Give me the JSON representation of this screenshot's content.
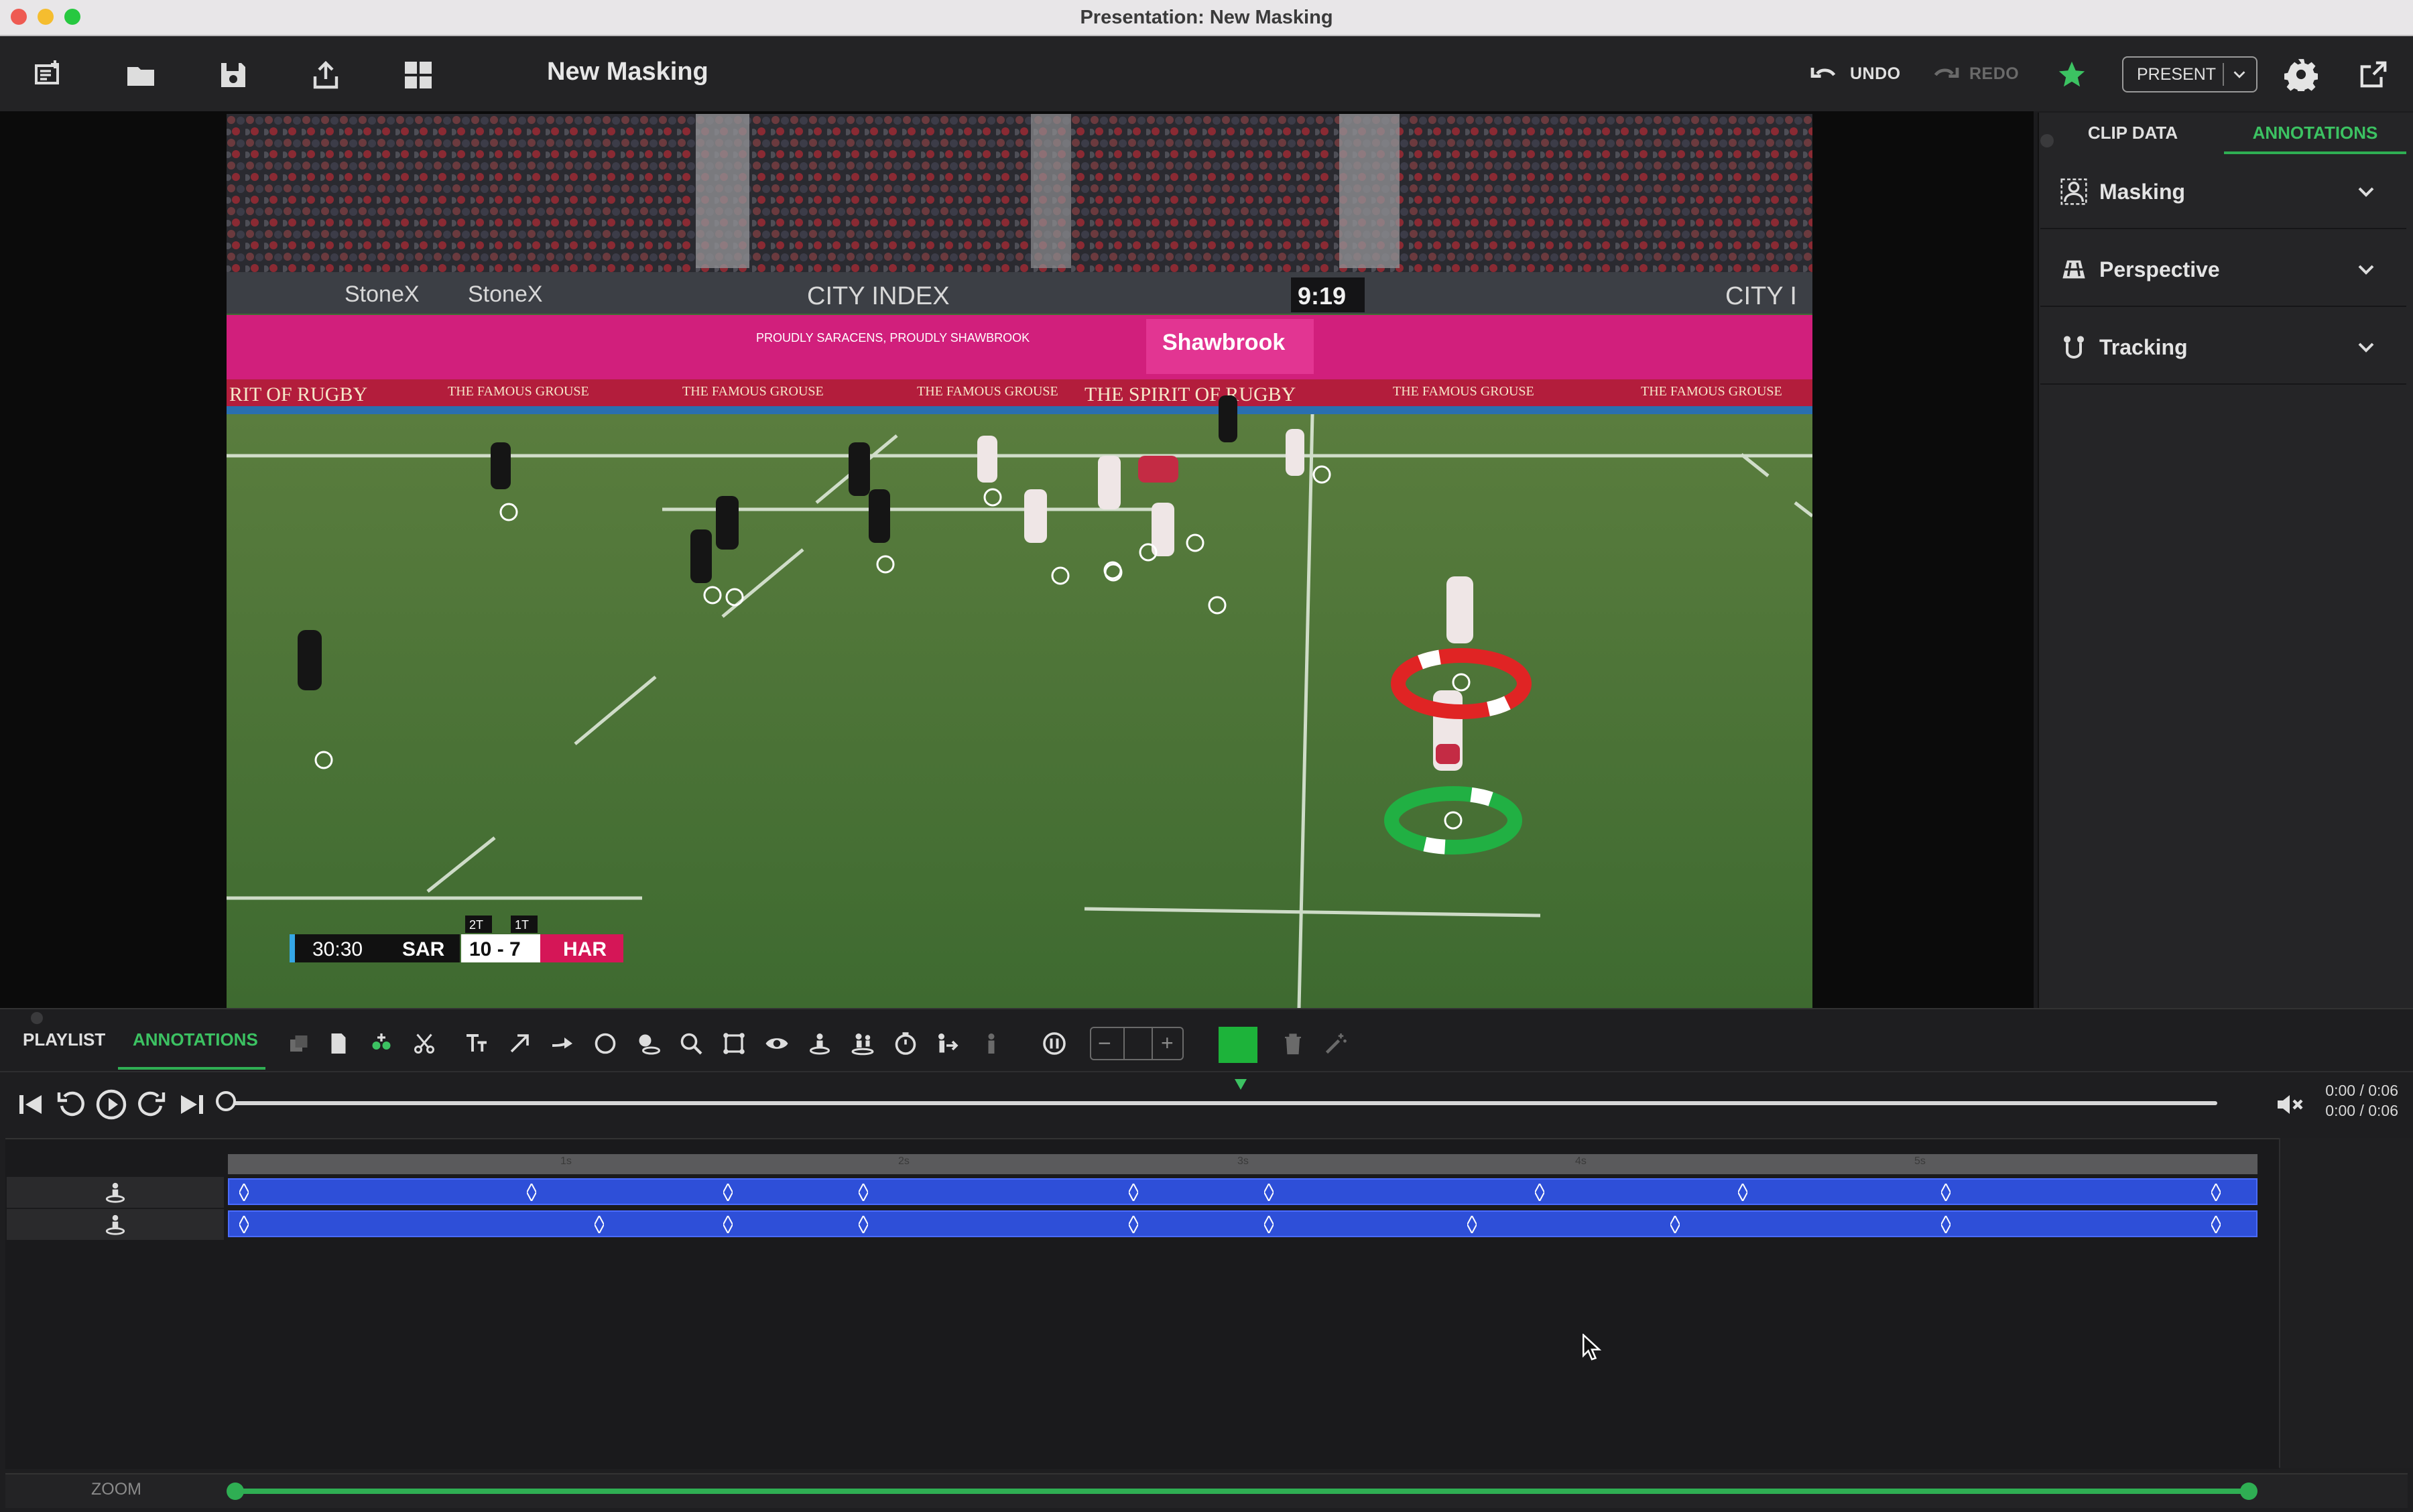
{
  "window": {
    "title": "Presentation: New Masking"
  },
  "toolbar": {
    "document_title": "New Masking",
    "undo_label": "UNDO",
    "redo_label": "REDO",
    "present_label": "PRESENT",
    "icons": [
      "new-presentation-icon",
      "folder-icon",
      "save-icon",
      "share-icon",
      "layout-icon",
      "undo-icon",
      "redo-icon",
      "star-icon",
      "gear-icon",
      "external-window-icon"
    ]
  },
  "video": {
    "scoreboard": {
      "clock": "30:30",
      "home": "SAR",
      "score": "10 - 7",
      "away": "HAR",
      "home_half": "2T",
      "away_half": "1T"
    },
    "stadium_clock": "9:19",
    "boards": [
      "StoneX",
      "StoneX",
      "CITY INDEX",
      "CITY I",
      "Shawbrook",
      "THE FAMOUS GROUSE",
      "THE FAMOUS GROUSE",
      "THE FAMOUS GROUSE",
      "THE FAMOUS GROUSE",
      "THE FAMOUS GROUSE",
      "THE SPIRIT OF RUGBY",
      "RIT OF RUGBY",
      "PROUDLY SARACENS, PROUDLY SHAWBROOK"
    ]
  },
  "right_panel": {
    "tabs": [
      {
        "label": "CLIP DATA"
      },
      {
        "label": "ANNOTATIONS",
        "active": true
      }
    ],
    "sections": [
      {
        "label": "Masking",
        "icon": "masking-icon"
      },
      {
        "label": "Perspective",
        "icon": "perspective-icon"
      },
      {
        "label": "Tracking",
        "icon": "tracking-icon"
      }
    ],
    "accent_color": "#2fae53"
  },
  "bottom": {
    "tabs": [
      {
        "label": "PLAYLIST"
      },
      {
        "label": "ANNOTATIONS",
        "active": true
      }
    ],
    "tools": [
      "copy-icon",
      "document-icon",
      "add-group-icon",
      "scissors-icon",
      "text-icon",
      "arrow-icon",
      "curved-arrow-icon",
      "circle-icon",
      "spotlight-icon",
      "magnifier-icon",
      "polygon-icon",
      "eye-icon",
      "player-marker-icon",
      "player-link-icon",
      "timer-icon",
      "movement-icon",
      "player-icon",
      "pause-icon",
      "stepper",
      "color-swatch",
      "trash-icon",
      "magic-wand-icon"
    ],
    "stepper_value": "",
    "color_swatch": "#1db33a",
    "time": {
      "current": "0:00 / 0:06",
      "total": "0:00 / 0:06"
    },
    "tracks": [
      {
        "icon": "player-marker-icon",
        "keyframes_s": [
          0.04,
          0.89,
          1.47,
          1.87,
          2.67,
          3.07,
          3.87,
          4.47,
          5.07,
          5.87
        ]
      },
      {
        "icon": "player-marker-icon",
        "keyframes_s": [
          0.04,
          1.09,
          1.47,
          1.87,
          2.67,
          3.07,
          3.67,
          4.27,
          5.07,
          5.87
        ]
      }
    ],
    "ruler": {
      "labels": [
        "1s",
        "2s",
        "3s",
        "4s",
        "5s"
      ]
    },
    "zoom_label": "ZOOM"
  }
}
